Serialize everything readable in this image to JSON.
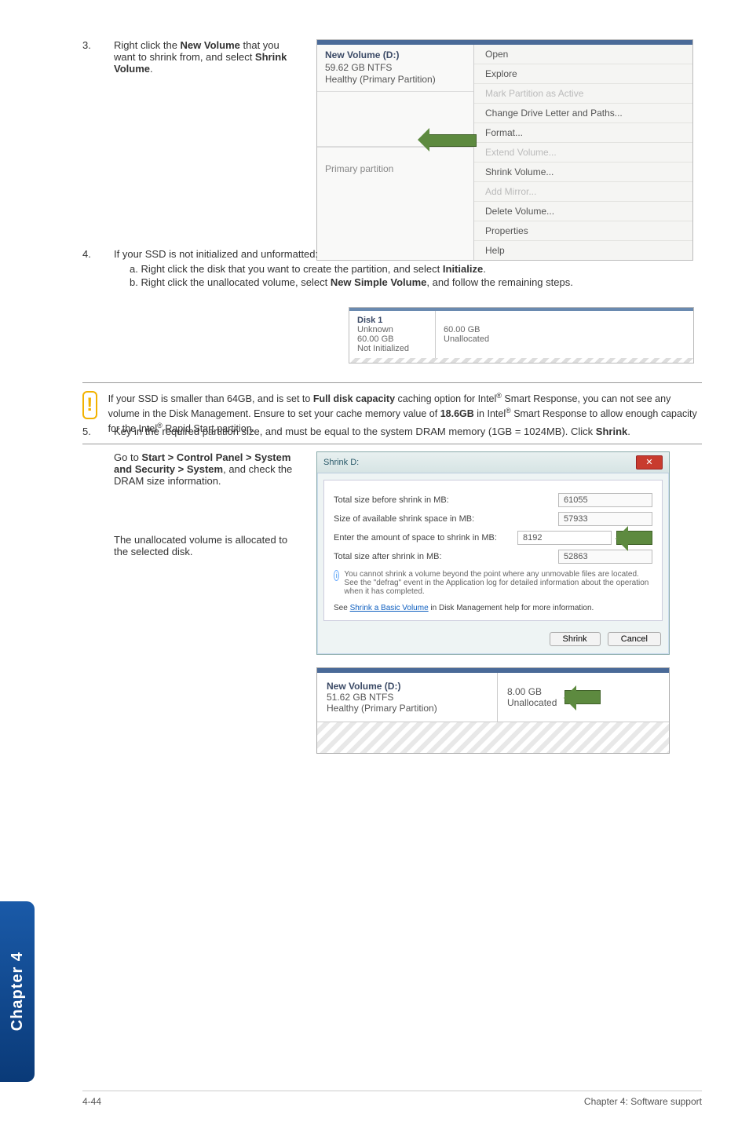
{
  "steps": {
    "s3": {
      "num": "3.",
      "text_a": "Right click the ",
      "bold_a": "New Volume",
      "text_b": " that you want to shrink from, and select ",
      "bold_b": "Shrink Volume",
      "text_c": "."
    },
    "s4": {
      "num": "4.",
      "text": "If your SSD is not initialized and unformatted:",
      "a_pre": "a.  Right click the disk that you want to create the partition, and select ",
      "a_bold": "Initialize",
      "a_post": ".",
      "b_pre": "b.  Right click the unallocated volume, select ",
      "b_bold": "New Simple Volume",
      "b_post": ", and follow the remaining steps."
    },
    "s5": {
      "num": "5.",
      "pre": "Key in the required partition size, and must be equal to the system DRAM memory (1GB = 1024MB). Click ",
      "bold": "Shrink",
      "post": "."
    }
  },
  "note": {
    "l1a": "If your SSD is smaller than 64GB, and is set to ",
    "l1b": "Full disk capacity",
    "l1c": " caching option for Intel",
    "l2": "Smart Response, you can not see any volume in the Disk Management. Ensure to set your cache memory value of ",
    "l2b": "18.6GB",
    "l2c": " in Intel",
    "l2d": " Smart Response to allow enough capacity for the Intel",
    "l2e": " Rapid Start partition.",
    "reg": "®"
  },
  "after5": {
    "p1a": "Go to ",
    "p1b": "Start > Control Panel > System and Security > System",
    "p1c": ", and check the DRAM size information.",
    "p2": "The unallocated volume is allocated to the selected disk."
  },
  "shot1": {
    "vol_title": "New Volume  (D:)",
    "vol_sub1": "59.62 GB NTFS",
    "vol_sub2": "Healthy (Primary Partition)",
    "primary": "Primary partition",
    "menu": {
      "open": "Open",
      "explore": "Explore",
      "mark": "Mark Partition as Active",
      "change": "Change Drive Letter and Paths...",
      "format": "Format...",
      "extend": "Extend Volume...",
      "shrink": "Shrink Volume...",
      "addmirror": "Add Mirror...",
      "delete": "Delete Volume...",
      "props": "Properties",
      "help": "Help"
    }
  },
  "disk1": {
    "title": "Disk 1",
    "l1": "Unknown",
    "l2": "60.00 GB",
    "l3": "Not Initialized",
    "r1": "60.00 GB",
    "r2": "Unallocated"
  },
  "dlg": {
    "title": "Shrink D:",
    "r1": "Total size before shrink in MB:",
    "v1": "61055",
    "r2": "Size of available shrink space in MB:",
    "v2": "57933",
    "r3": "Enter the amount of space to shrink in MB:",
    "v3": "8192",
    "r4": "Total size after shrink in MB:",
    "v4": "52863",
    "info": "You cannot shrink a volume beyond the point where any unmovable files are located. See the \"defrag\" event in the Application log for detailed information about the operation when it has completed.",
    "see_a": "See ",
    "see_link": "Shrink a Basic Volume",
    "see_b": " in Disk Management help for more information.",
    "btn_shrink": "Shrink",
    "btn_cancel": "Cancel"
  },
  "nv": {
    "title": "New Volume  (D:)",
    "l1": "51.62 GB NTFS",
    "l2": "Healthy (Primary Partition)",
    "r1": "8.00 GB",
    "r2": "Unallocated"
  },
  "sidetab": "Chapter 4",
  "footer": {
    "left": "4-44",
    "right": "Chapter 4: Software support"
  }
}
